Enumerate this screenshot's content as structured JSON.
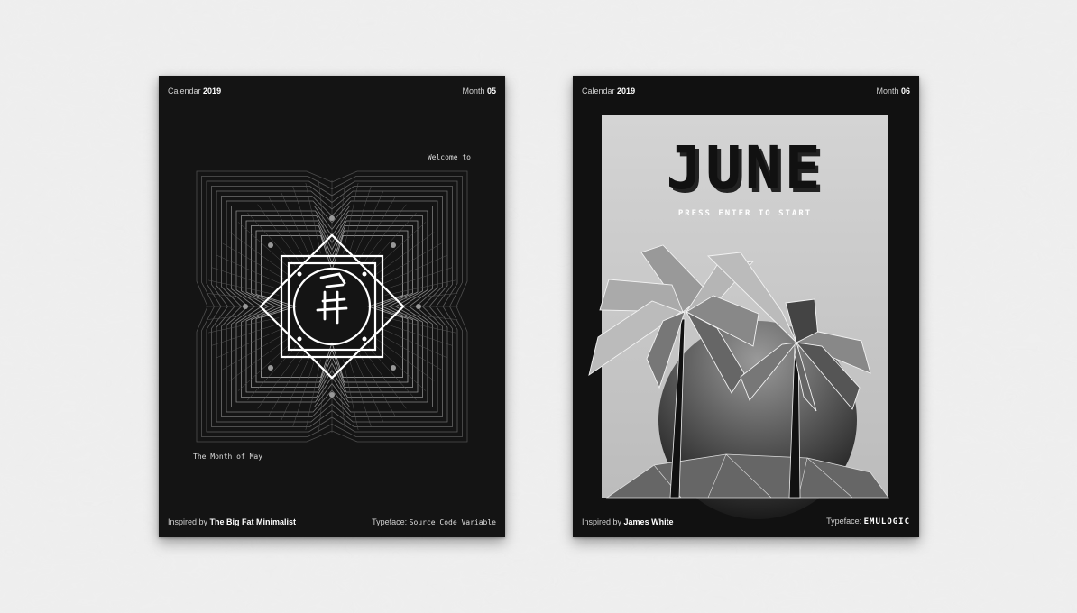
{
  "poster_may": {
    "calendar_label": "Calendar",
    "year": "2019",
    "month_label": "Month",
    "month_number": "05",
    "welcome_text": "Welcome to",
    "month_caption": "The Month of May",
    "inspired_label": "Inspired by",
    "inspired_name": "The Big Fat Minimalist",
    "typeface_label": "Typeface:",
    "typeface_name": "Source Code Variable"
  },
  "poster_june": {
    "calendar_label": "Calendar",
    "year": "2019",
    "month_label": "Month",
    "month_number": "06",
    "title": "JUNE",
    "prompt": "PRESS ENTER TO START",
    "inspired_label": "Inspired by",
    "inspired_name": "James White",
    "typeface_label": "Typeface:",
    "typeface_name": "EMULOGIC"
  },
  "colors": {
    "wall": "#ececec",
    "poster_background": "#141414",
    "line": "#ffffff",
    "panel": "#c8c8c8"
  }
}
